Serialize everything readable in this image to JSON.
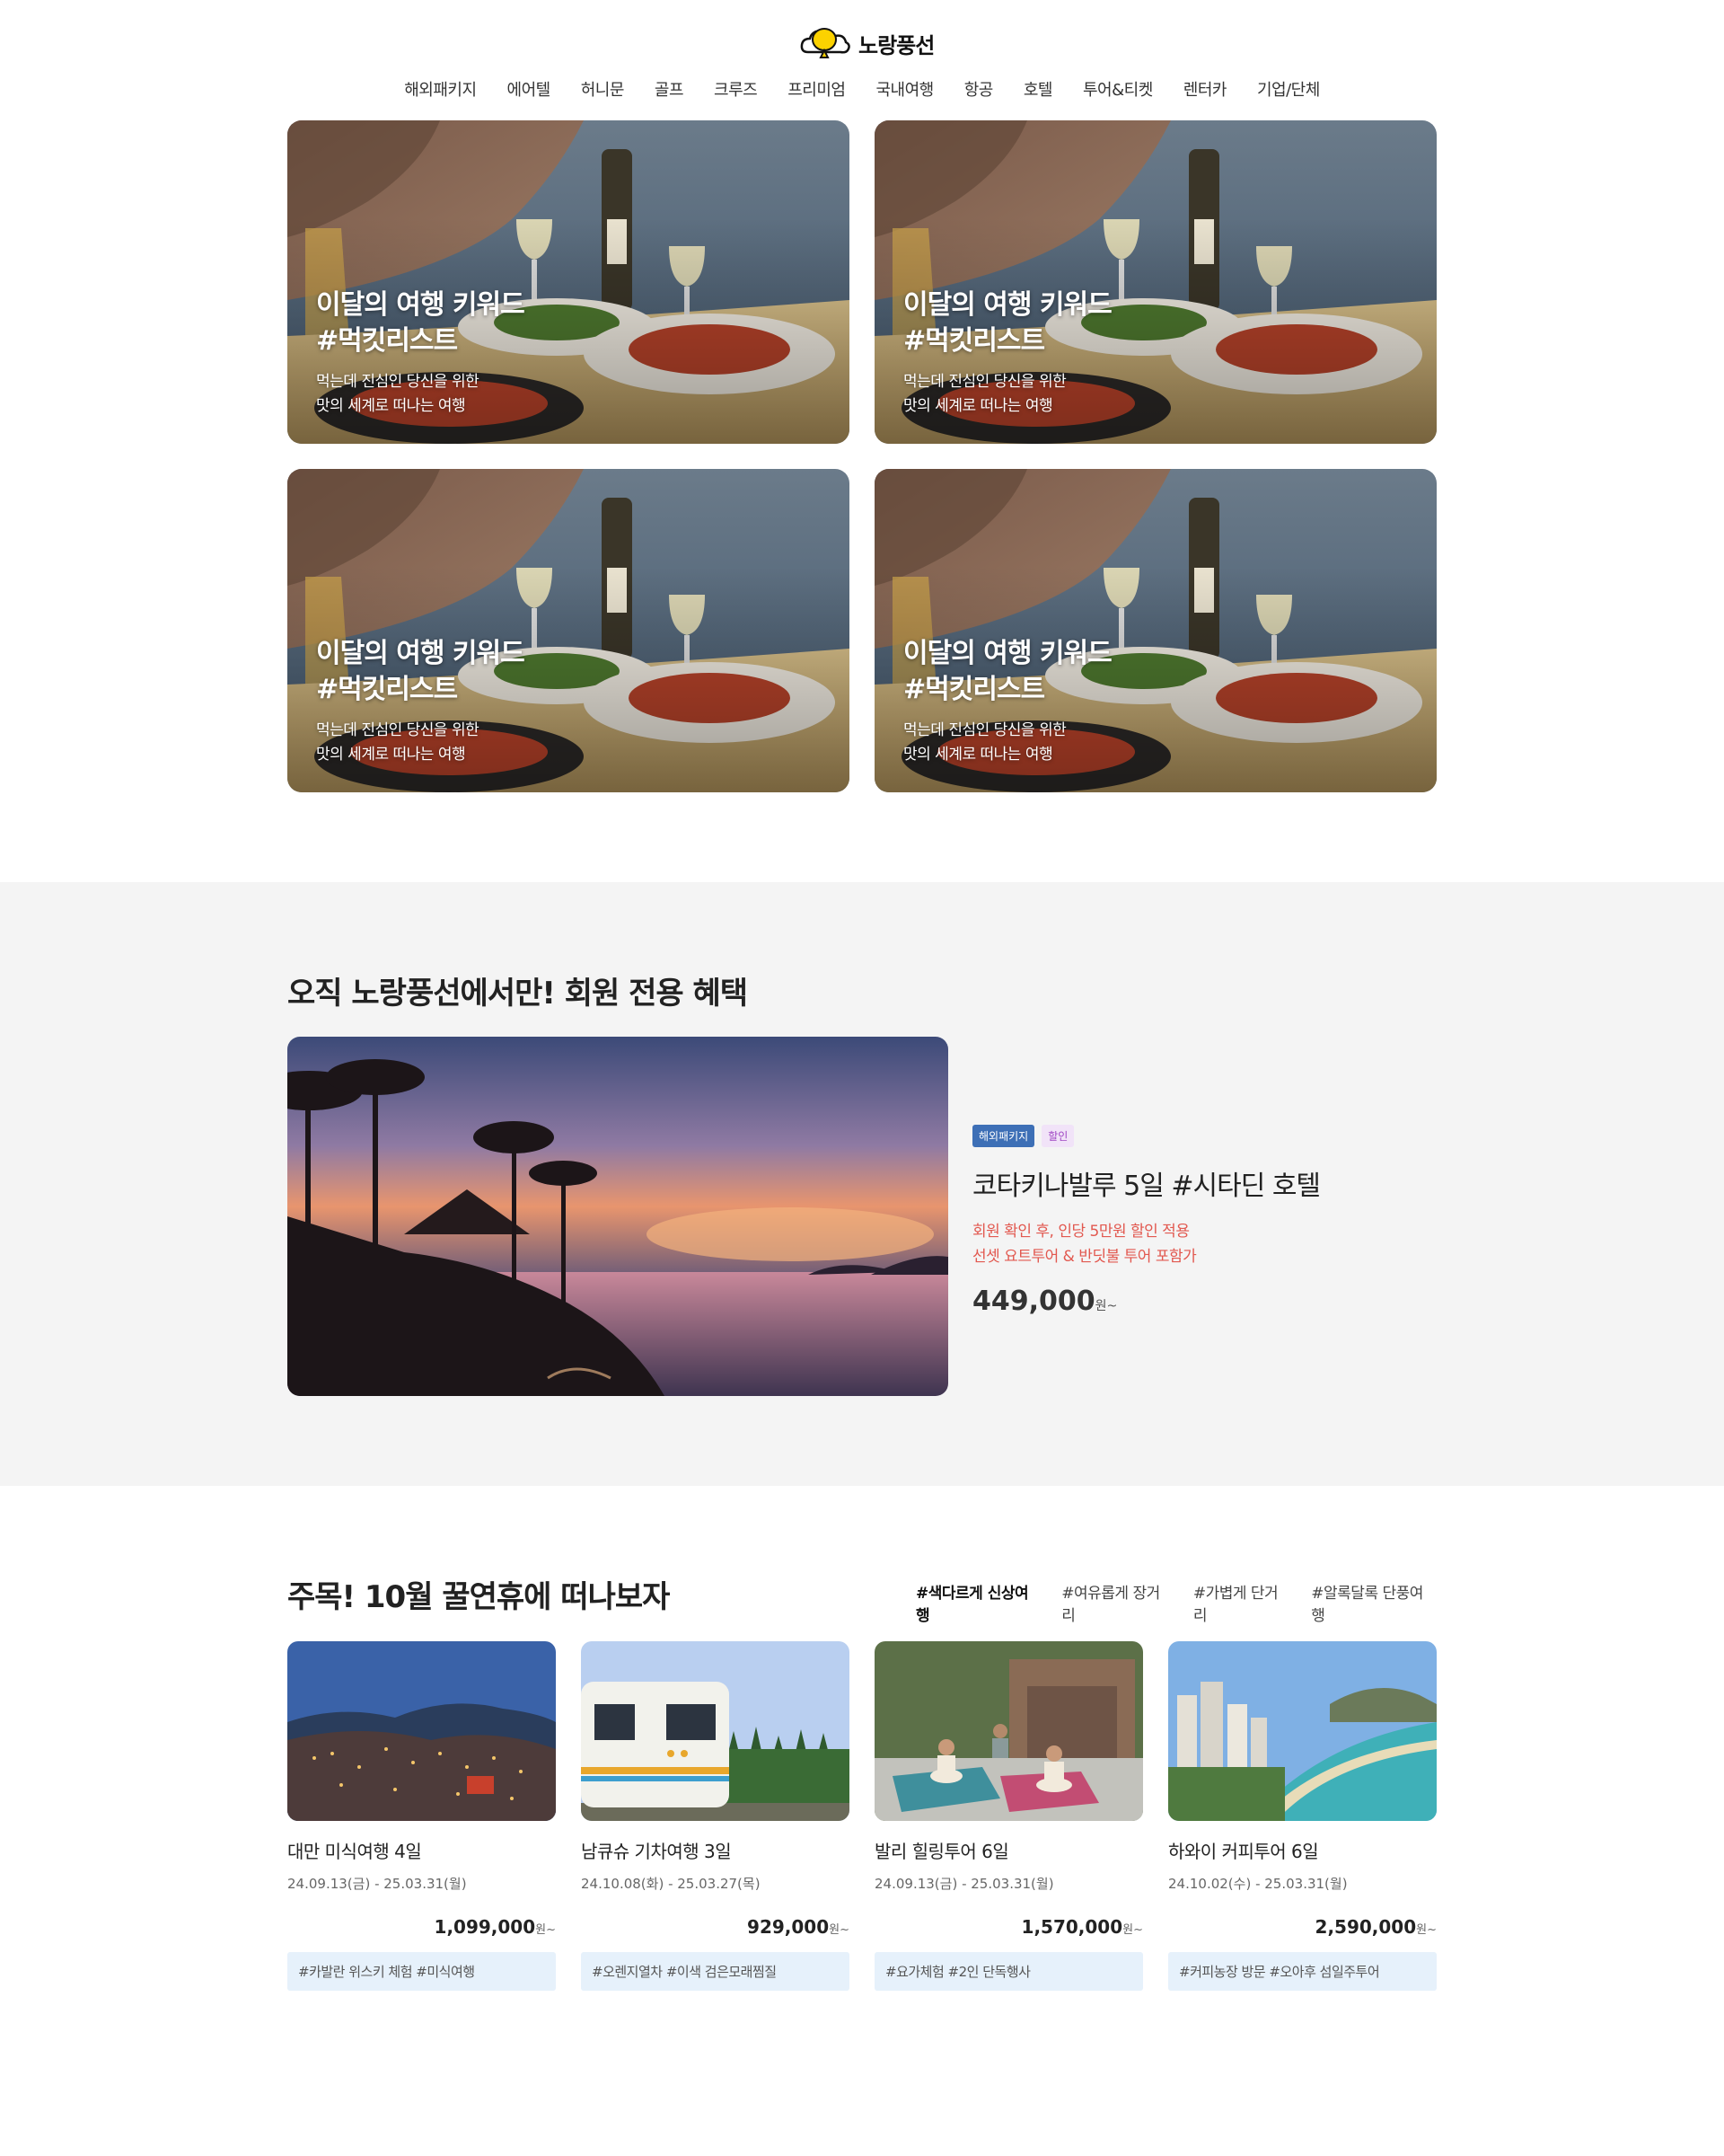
{
  "brand": {
    "name": "노랑풍선",
    "color": "#fcd200"
  },
  "nav": [
    "해외패키지",
    "에어텔",
    "허니문",
    "골프",
    "크루즈",
    "프리미엄",
    "국내여행",
    "항공",
    "호텔",
    "투어&티켓",
    "렌터카",
    "기업/단체"
  ],
  "keyword_cards": [
    {
      "title1": "이달의 여행 키워드",
      "title2": "#먹킷리스트",
      "desc1": "먹는데 진심인 당신을 위한",
      "desc2": "맛의 세계로 떠나는 여행"
    },
    {
      "title1": "이달의 여행 키워드",
      "title2": "#먹킷리스트",
      "desc1": "먹는데 진심인 당신을 위한",
      "desc2": "맛의 세계로 떠나는 여행"
    },
    {
      "title1": "이달의 여행 키워드",
      "title2": "#먹킷리스트",
      "desc1": "먹는데 진심인 당신을 위한",
      "desc2": "맛의 세계로 떠나는 여행"
    },
    {
      "title1": "이달의 여행 키워드",
      "title2": "#먹킷리스트",
      "desc1": "먹는데 진심인 당신을 위한",
      "desc2": "맛의 세계로 떠나는 여행"
    }
  ],
  "member": {
    "title_light": "오직 노랑풍선에서만!",
    "title_bold": "회원 전용 혜택",
    "badge1": "해외패키지",
    "badge2": "할인",
    "name": "코타키나발루 5일 #시타딘 호텔",
    "note1": "회원 확인 후, 인당 5만원 할인 적용",
    "note2": "선셋 요트투어 & 반딧불 투어 포함가",
    "price": "449,000",
    "price_unit": "원~"
  },
  "featured": {
    "title": "주목! 10월 꿀연휴에 떠나보자",
    "tags": [
      "#색다르게 신상여행",
      "#여유롭게 장거리",
      "#가볍게 단거리",
      "#알록달록 단풍여행"
    ],
    "products": [
      {
        "name": "대만 미식여행 4일",
        "date": "24.09.13(금) - 25.03.31(월)",
        "price": "1,099,000",
        "unit": "원~",
        "tags": "#카발란 위스키 체험 #미식여행"
      },
      {
        "name": "남큐슈 기차여행 3일",
        "date": "24.10.08(화) - 25.03.27(목)",
        "price": "929,000",
        "unit": "원~",
        "tags": "#오렌지열차 #이색 검은모래찜질"
      },
      {
        "name": "발리 힐링투어 6일",
        "date": "24.09.13(금) - 25.03.31(월)",
        "price": "1,570,000",
        "unit": "원~",
        "tags": "#요가체험 #2인 단독행사"
      },
      {
        "name": "하와이 커피투어 6일",
        "date": "24.10.02(수) - 25.03.31(월)",
        "price": "2,590,000",
        "unit": "원~",
        "tags": "#커피농장 방문 #오아후 섬일주투어"
      }
    ]
  }
}
